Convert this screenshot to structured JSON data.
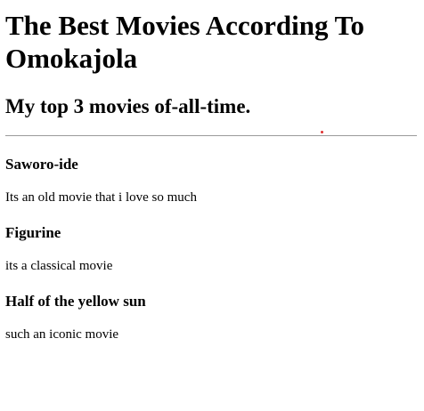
{
  "page": {
    "title": "The Best Movies According To Omokajola",
    "subtitle": "My top 3 movies of-all-time."
  },
  "movies": [
    {
      "title": "Saworo-ide",
      "description": "Its an old movie that i love so much"
    },
    {
      "title": "Figurine",
      "description": "its a classical movie"
    },
    {
      "title": "Half of the yellow sun",
      "description": "such an iconic movie"
    }
  ],
  "colors": {
    "divider": "#9a9a9a",
    "dot": "#e03030",
    "text": "#000000"
  }
}
